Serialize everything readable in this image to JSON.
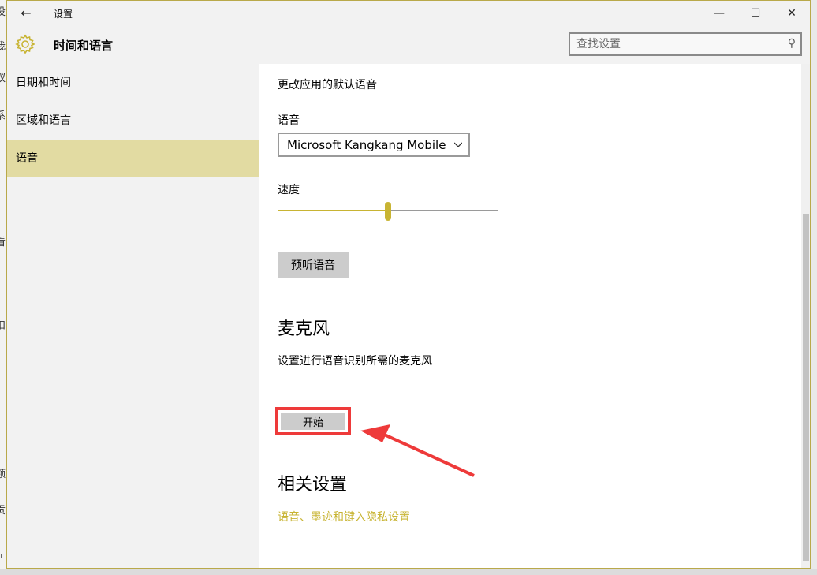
{
  "window": {
    "title": "设置",
    "back_glyph": "←",
    "minimize_glyph": "—",
    "maximize_glyph": "☐",
    "close_glyph": "✕"
  },
  "header": {
    "title": "时间和语言",
    "icon": "gear-icon",
    "search_placeholder": "查找设置",
    "search_value": "",
    "search_glyph": "⚲"
  },
  "sidebar": {
    "items": [
      {
        "label": "日期和时间",
        "selected": false
      },
      {
        "label": "区域和语言",
        "selected": false
      },
      {
        "label": "语音",
        "selected": true
      }
    ]
  },
  "main": {
    "description": "更改应用的默认语音",
    "voice_label": "语音",
    "voice_value": "Microsoft Kangkang Mobile",
    "speed_label": "速度",
    "speed_value": 0.5,
    "preview_button": "预听语音",
    "mic_heading": "麦克风",
    "mic_description": "设置进行语音识别所需的麦克风",
    "start_button": "开始",
    "related_heading": "相关设置",
    "related_link": "语音、墨迹和键入隐私设置"
  },
  "colors": {
    "accent": "#c8b433",
    "selected_nav": "#e2dba2",
    "highlight_box": "#ee3a3a"
  }
}
